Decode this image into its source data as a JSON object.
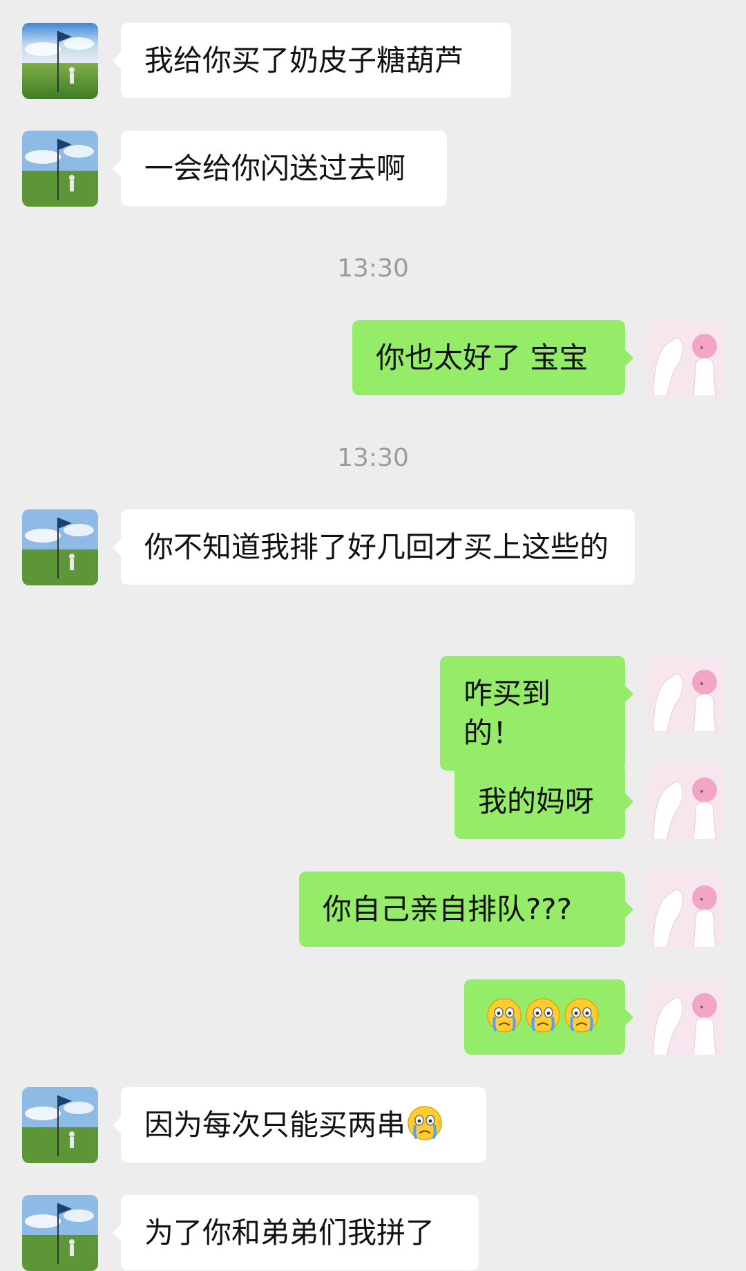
{
  "messages": [
    {
      "side": "left",
      "text": "我给你买了奶皮子糖葫芦"
    },
    {
      "side": "left",
      "text": "一会给你闪送过去啊"
    },
    {
      "time": "13:30"
    },
    {
      "side": "right",
      "text": "你也太好了 宝宝"
    },
    {
      "time": "13:30"
    },
    {
      "side": "left",
      "text": "你不知道我排了好几回才买上这些的"
    },
    {
      "side": "right",
      "text": "咋买到的！"
    },
    {
      "side": "right",
      "text": "我的妈呀"
    },
    {
      "side": "right",
      "text": "你自己亲自排队???"
    },
    {
      "side": "right",
      "emoji": [
        "crying-face-emoji",
        "crying-face-emoji",
        "crying-face-emoji"
      ]
    },
    {
      "side": "left",
      "text": "因为每次只能买两串",
      "emoji": [
        "crying-face-emoji"
      ]
    },
    {
      "side": "left",
      "text": "为了你和弟弟们我拼了"
    }
  ],
  "colors": {
    "background": "#ededed",
    "incoming_bubble": "#ffffff",
    "outgoing_bubble": "#95ec69",
    "timestamp_text": "#9b9b9b"
  }
}
